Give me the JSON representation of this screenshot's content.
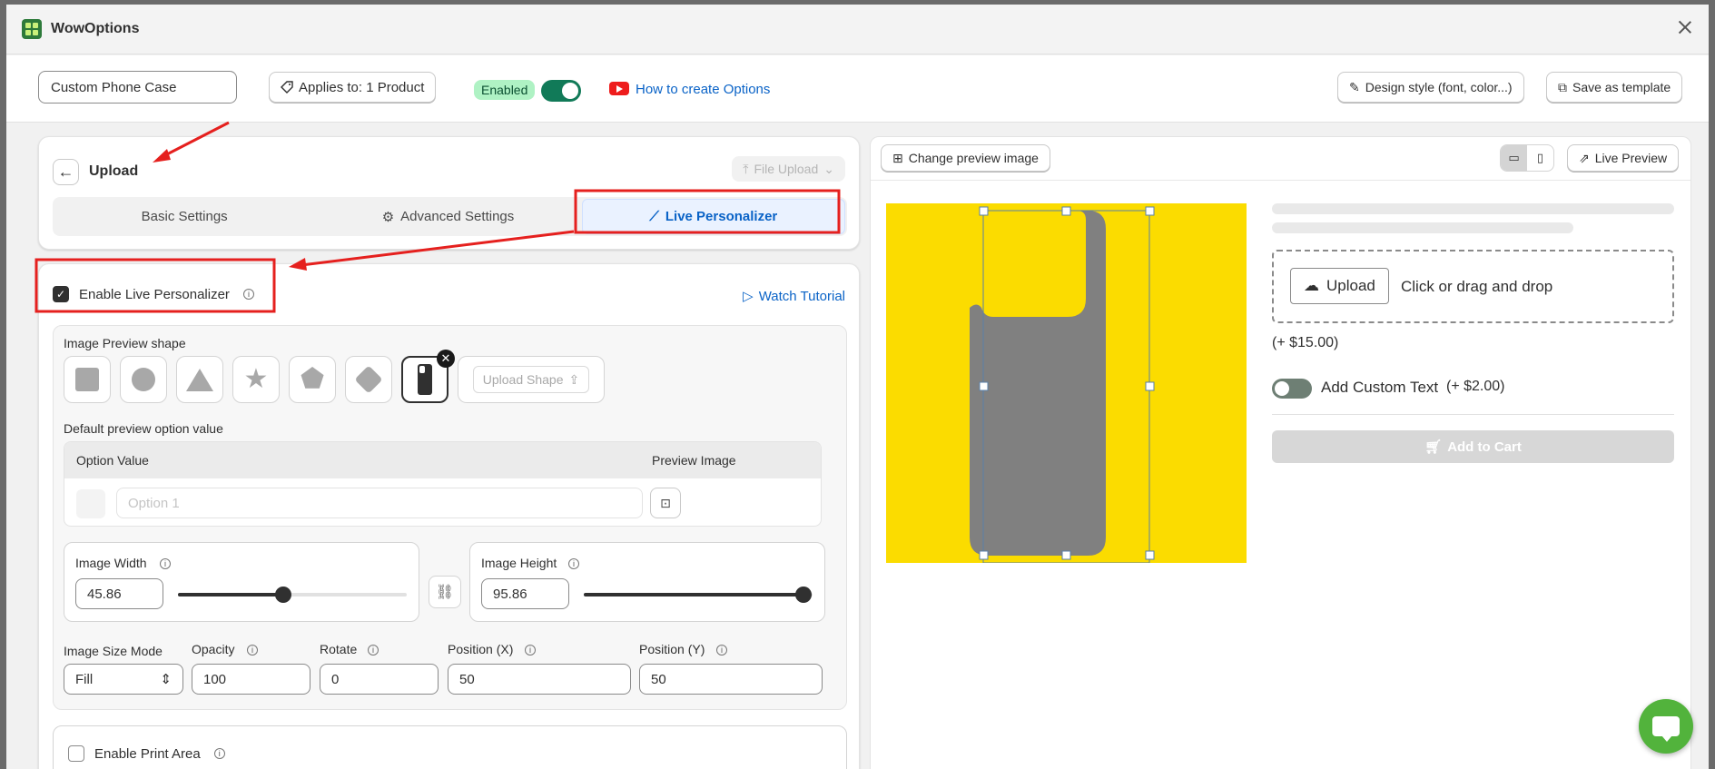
{
  "app": {
    "title": "WowOptions"
  },
  "toolbar": {
    "option_name": "Custom Phone Case",
    "applies_label": "Applies to: 1 Product",
    "enabled_label": "Enabled",
    "howto_label": "How to create Options",
    "design_label": "Design style (font, color...)",
    "save_template_label": "Save as template"
  },
  "editor": {
    "title": "Upload",
    "type_dropdown": "File Upload",
    "tabs": [
      {
        "label": "Basic Settings"
      },
      {
        "label": "Advanced Settings"
      },
      {
        "label": "Live Personalizer"
      }
    ],
    "active_tab": 2
  },
  "personalizer": {
    "enable_label": "Enable Live Personalizer",
    "enabled": true,
    "watch_tutorial": "Watch Tutorial",
    "shape_label": "Image Preview shape",
    "shapes": [
      "square",
      "circle",
      "triangle",
      "star",
      "pentagon",
      "diamond",
      "phone-case"
    ],
    "selected_shape": "phone-case",
    "upload_shape_label": "Upload Shape",
    "default_preview_label": "Default preview option value",
    "table": {
      "col_option": "Option Value",
      "col_preview": "Preview Image",
      "option_placeholder": "Option 1"
    },
    "width": {
      "label": "Image Width",
      "value": "45.86",
      "fraction": 0.4586
    },
    "height": {
      "label": "Image Height",
      "value": "95.86",
      "fraction": 0.9586
    },
    "size_mode": {
      "label": "Image Size Mode",
      "value": "Fill"
    },
    "opacity": {
      "label": "Opacity",
      "value": "100"
    },
    "rotate": {
      "label": "Rotate",
      "value": "0"
    },
    "pos_x": {
      "label": "Position (X)",
      "value": "50"
    },
    "pos_y": {
      "label": "Position (Y)",
      "value": "50"
    },
    "print_area_label": "Enable Print Area",
    "print_area_enabled": false
  },
  "preview": {
    "change_image_label": "Change preview image",
    "live_preview_label": "Live Preview",
    "background_color": "#fbdc00",
    "shape_color": "#808080",
    "upload_btn": "Upload",
    "dropzone_text": "Click or drag and drop",
    "upload_price": "(+ $15.00)",
    "custom_text_label": "Add Custom Text",
    "custom_text_price": "(+ $2.00)",
    "add_to_cart": "Add to Cart"
  },
  "colors": {
    "accent": "#0a63c7",
    "annotation": "#e5201e",
    "toggle_on": "#117a58"
  }
}
